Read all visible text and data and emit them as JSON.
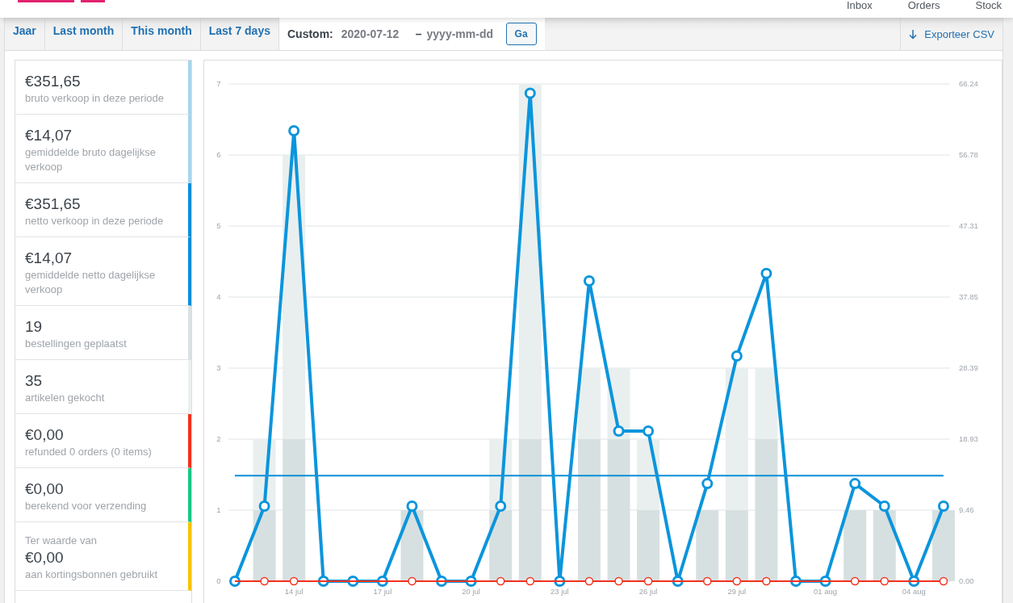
{
  "topnav": {
    "items": [
      "Inbox",
      "Orders",
      "Stock"
    ]
  },
  "ranges": {
    "tabs": [
      {
        "label": "Jaar",
        "selected": false
      },
      {
        "label": "Last month",
        "selected": false
      },
      {
        "label": "This month",
        "selected": false
      },
      {
        "label": "Last 7 days",
        "selected": false
      }
    ],
    "custom": {
      "label": "Custom:",
      "selected": true,
      "start": "2020-07-12",
      "separator": "–",
      "end_placeholder": "yyyy-mm-dd",
      "button": "Ga"
    },
    "export": "Exporteer CSV"
  },
  "legend": [
    {
      "value": "€351,65",
      "label": "bruto verkoop in deze periode",
      "color": "#a8d4ec"
    },
    {
      "value": "€14,07",
      "label": "gemiddelde bruto dagelijkse verkoop",
      "color": "#a8d4ec"
    },
    {
      "value": "€351,65",
      "label": "netto verkoop in deze periode",
      "color": "#0b8fd8"
    },
    {
      "value": "€14,07",
      "label": "gemiddelde netto dagelijkse verkoop",
      "color": "#0b8fd8"
    },
    {
      "value": "19",
      "label": "bestellingen geplaatst",
      "color": "#dbe1e3"
    },
    {
      "value": "35",
      "label": "artikelen gekocht",
      "color": "#ecf0f1"
    },
    {
      "value": "€0,00",
      "label": "refunded 0 orders (0 items)",
      "color": "#f2321f"
    },
    {
      "value": "€0,00",
      "label": "berekend voor verzending",
      "color": "#17c883"
    },
    {
      "prefix": "Ter waarde van",
      "value": "€0,00",
      "label": "aan kortingsbonnen gebruikt",
      "color": "#f7c300"
    }
  ],
  "chart": {
    "chart_data": {
      "type": "bar",
      "categories": [
        null,
        null,
        "14 jul",
        null,
        null,
        "17 jul",
        null,
        null,
        "20 jul",
        null,
        null,
        "23 jul",
        null,
        null,
        "26 jul",
        null,
        null,
        "29 jul",
        null,
        null,
        "01 aug",
        null,
        null,
        "04 aug",
        null
      ],
      "ylim": [
        0,
        7
      ],
      "yticks": [
        0,
        1,
        2,
        3,
        4,
        5,
        6,
        7
      ],
      "y2lim": [
        0,
        66.24
      ],
      "y2ticks": [
        {
          "value": 0,
          "label": "0.00"
        },
        {
          "value": 9.46,
          "label": "9.46"
        },
        {
          "value": 18.93,
          "label": "18.93"
        },
        {
          "value": 28.39,
          "label": "28.39"
        },
        {
          "value": 37.85,
          "label": "37.85"
        },
        {
          "value": 47.31,
          "label": "47.31"
        },
        {
          "value": 56.78,
          "label": "56.78"
        },
        {
          "value": 66.24,
          "label": "66.24"
        }
      ],
      "stacked": true,
      "ref_lines": [
        {
          "axis": "y2",
          "value": 14.07,
          "color": "#0b8fd8"
        }
      ],
      "series": [
        {
          "color": "#d7e0e1",
          "values": [
            0,
            1,
            2,
            0,
            0,
            0,
            1,
            0,
            0,
            1,
            2,
            0,
            2,
            2,
            1,
            0,
            1,
            1,
            2,
            0,
            0,
            1,
            1,
            0,
            1
          ]
        },
        {
          "color": "#e9efef",
          "values": [
            0,
            1,
            4,
            0,
            0,
            0,
            0,
            0,
            0,
            1,
            5,
            0,
            1,
            1,
            1,
            0,
            0,
            2,
            1,
            0,
            0,
            0,
            0,
            0,
            0
          ]
        },
        {
          "type": "line",
          "marker": true,
          "axis": "y2",
          "color": "#0b95dc",
          "values": [
            0,
            10,
            60,
            0,
            0,
            0,
            10,
            0,
            0,
            10,
            65,
            0,
            40,
            20,
            20,
            0,
            13,
            30,
            41,
            0,
            0,
            13,
            10,
            0,
            10
          ]
        },
        {
          "type": "line",
          "marker": true,
          "axis": "y2",
          "color": "#f2321f",
          "values": [
            0,
            0,
            0,
            0,
            0,
            0,
            0,
            0,
            0,
            0,
            0,
            0,
            0,
            0,
            0,
            0,
            0,
            0,
            0,
            0,
            0,
            0,
            0,
            0,
            0
          ]
        }
      ]
    }
  }
}
